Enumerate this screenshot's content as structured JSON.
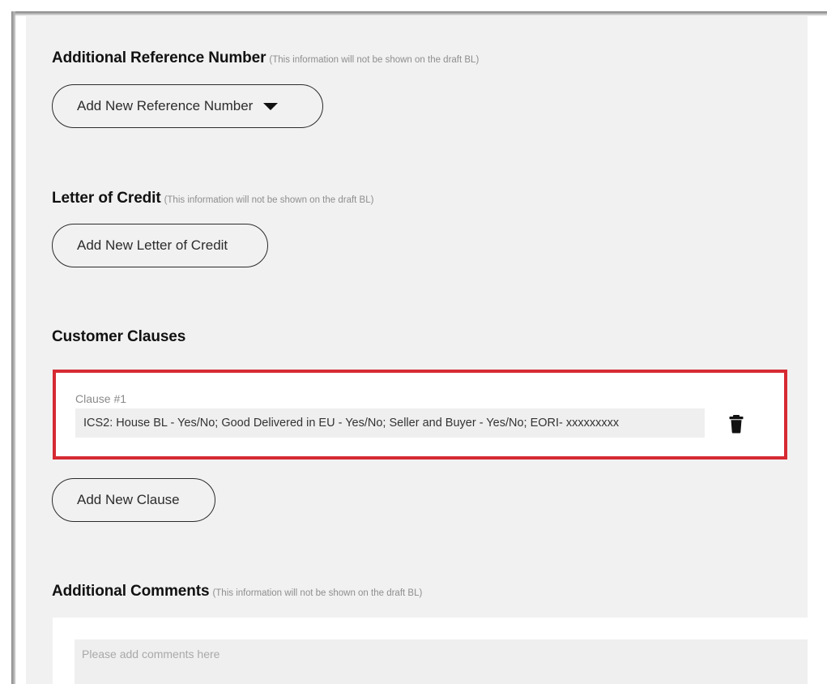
{
  "reference": {
    "title": "Additional Reference Number",
    "note": "(This information will not be shown on the draft BL)",
    "button_label": "Add New Reference Number"
  },
  "letter_of_credit": {
    "title": "Letter of Credit",
    "note": "(This information will not be shown on the draft BL)",
    "button_label": "Add New Letter of Credit"
  },
  "customer_clauses": {
    "title": "Customer Clauses",
    "clauses": [
      {
        "label": "Clause #1",
        "value": "ICS2: House BL - Yes/No; Good Delivered in EU - Yes/No; Seller and Buyer - Yes/No; EORI- xxxxxxxxx"
      }
    ],
    "add_button_label": "Add New Clause",
    "highlight_color": "#d62a33"
  },
  "comments": {
    "title": "Additional Comments",
    "note": "(This information will not be shown on the draft BL)",
    "placeholder": "Please add comments here"
  },
  "icons": {
    "dropdown": "caret-down-icon",
    "delete": "trash-icon"
  }
}
